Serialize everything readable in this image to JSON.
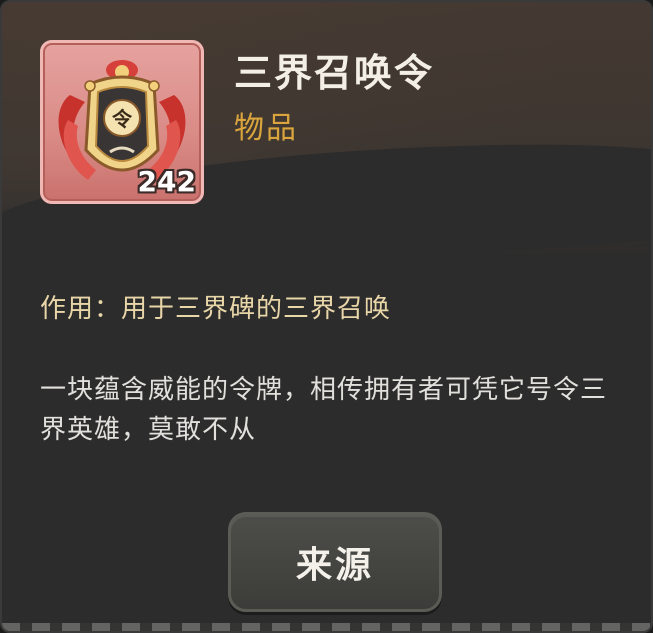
{
  "item": {
    "name": "三界召唤令",
    "type": "物品",
    "count": "242",
    "icon": "summon-token-icon"
  },
  "details": {
    "usage": "作用：用于三界碑的三界召唤",
    "description": "一块蕴含威能的令牌，相传拥有者可凭它号令三界英雄，莫敢不从"
  },
  "actions": {
    "source_label": "来源"
  },
  "colors": {
    "panel_bg": "#2c2c2c",
    "type_text": "#d9a53c",
    "usage_text": "#e9d6a8",
    "item_frame": "#d98a85"
  }
}
